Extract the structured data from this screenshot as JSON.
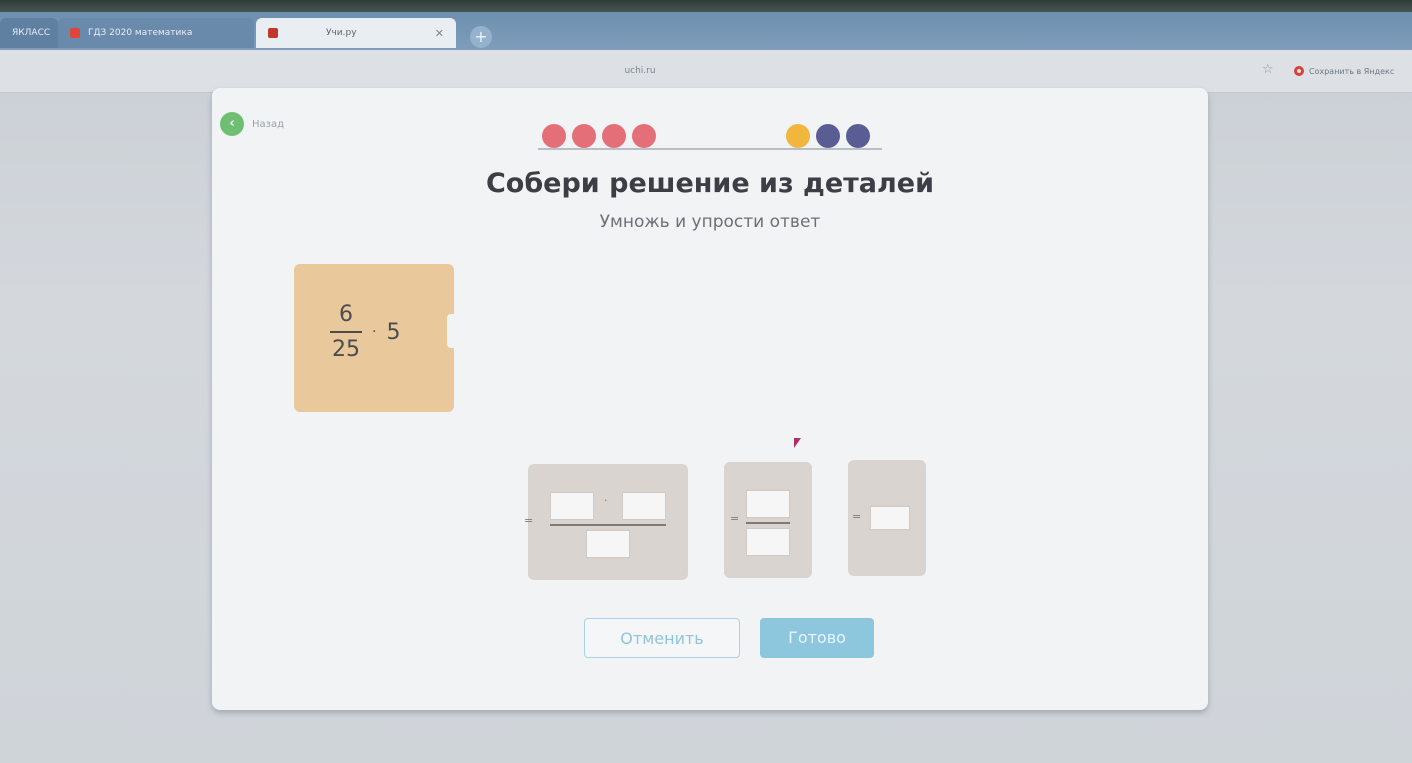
{
  "browser": {
    "tabs": [
      {
        "label": "ЯКЛАСС",
        "favicon_color": "#e9eef3"
      },
      {
        "label": "ГДЗ 2020 математика",
        "favicon_color": "#e0453a"
      },
      {
        "label": "Учи.ру",
        "favicon_color": "#c0392b"
      }
    ],
    "new_tab_label": "+",
    "url": "uchi.ru",
    "star_icon": "☆",
    "extension_label": "Сохранить в Яндекс"
  },
  "page": {
    "back_label": "Назад",
    "progress": {
      "completed_color": "#e56f78",
      "current_color": "#f0b63e",
      "pending_color": "#5a5d94",
      "dots": [
        {
          "state": "completed"
        },
        {
          "state": "completed"
        },
        {
          "state": "completed"
        },
        {
          "state": "completed"
        },
        {
          "state": "current"
        },
        {
          "state": "pending"
        },
        {
          "state": "pending"
        }
      ]
    },
    "title": "Собери решение из деталей",
    "subtitle": "Умножь и упрости ответ",
    "expression": {
      "numerator": "6",
      "denominator": "25",
      "operator": "·",
      "multiplier": "5"
    },
    "answer_slots": [
      {
        "equals": "=",
        "operator": "·"
      },
      {
        "equals": "="
      },
      {
        "equals": "="
      }
    ],
    "buttons": {
      "cancel": "Отменить",
      "done": "Готово"
    }
  }
}
